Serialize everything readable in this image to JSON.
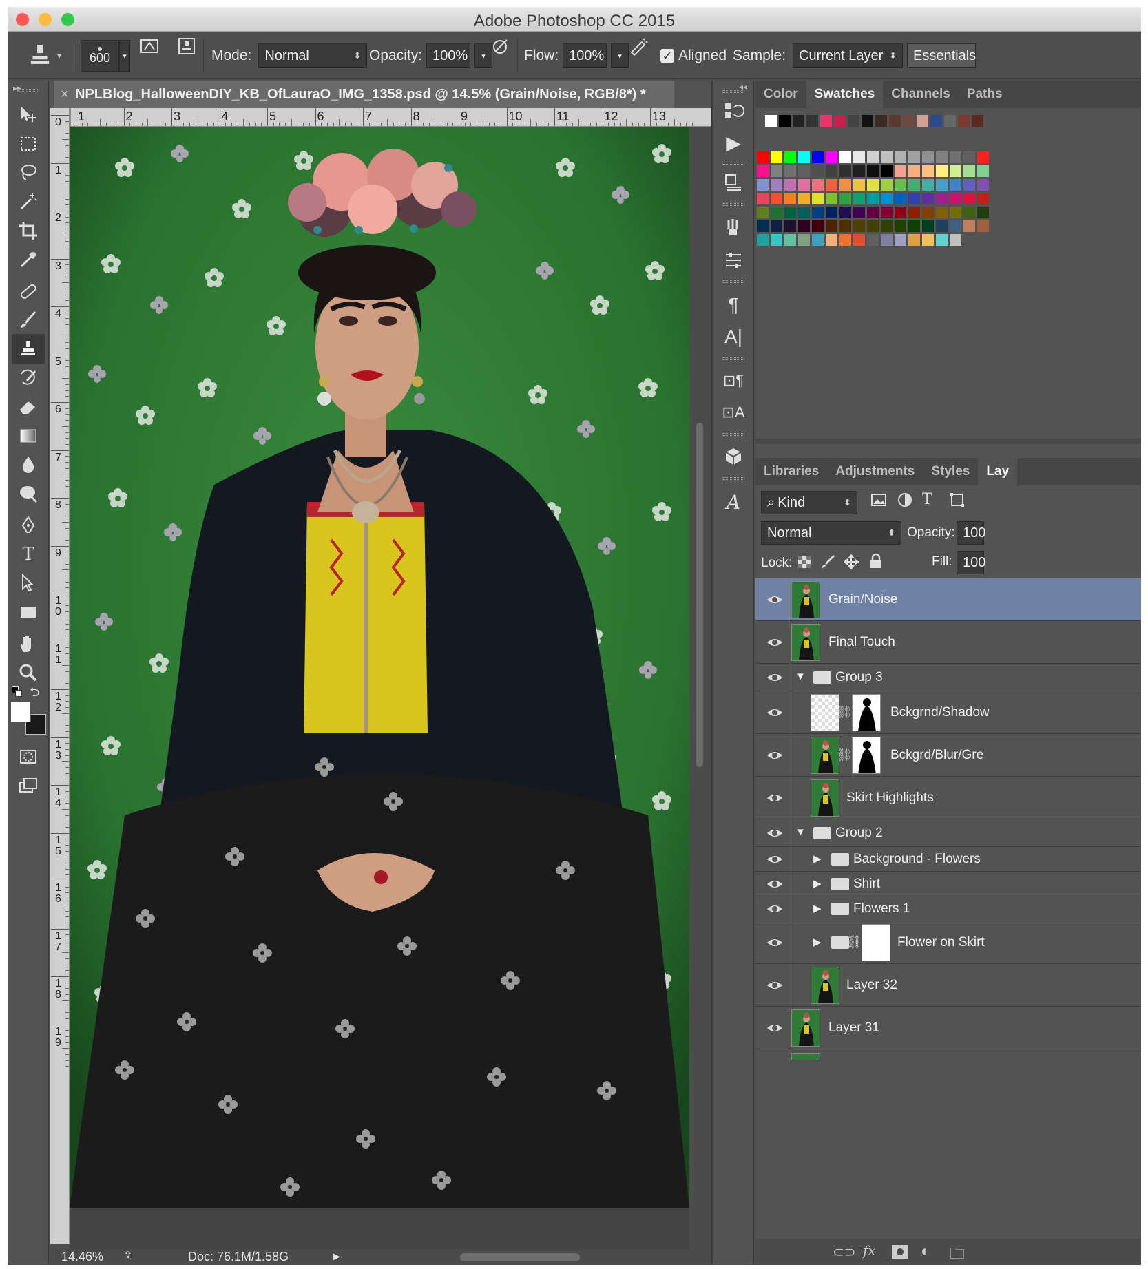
{
  "window": {
    "title": "Adobe Photoshop CC 2015"
  },
  "options": {
    "brush_size": "600",
    "mode_label": "Mode:",
    "mode_value": "Normal",
    "opacity_label": "Opacity:",
    "opacity_value": "100%",
    "flow_label": "Flow:",
    "flow_value": "100%",
    "aligned_label": "Aligned",
    "aligned_checked": true,
    "sample_label": "Sample:",
    "sample_value": "Current Layer",
    "workspace": "Essentials"
  },
  "document": {
    "tab_title": "NPLBlog_HalloweenDIY_KB_OfLauraO_IMG_1358.psd @ 14.5% (Grain/Noise, RGB/8*) *",
    "hruler": [
      "1",
      "2",
      "3",
      "4",
      "5",
      "6",
      "7",
      "8",
      "9",
      "10",
      "11",
      "12",
      "13"
    ],
    "vruler": [
      "0",
      "1",
      "2",
      "3",
      "4",
      "5",
      "6",
      "7",
      "8",
      "9",
      "10",
      "11",
      "12",
      "13",
      "14",
      "15",
      "16",
      "17",
      "18",
      "19"
    ],
    "zoom": "14.46%",
    "doc_size": "Doc: 76.1M/1.58G"
  },
  "panels": {
    "top_tabs": [
      "Color",
      "Swatches",
      "Channels",
      "Paths"
    ],
    "top_active": 1,
    "bottom_tabs": [
      "Libraries",
      "Adjustments",
      "Styles",
      "Lay"
    ],
    "bottom_active": 3
  },
  "layers_panel": {
    "filter_kind": "Kind",
    "blend_mode": "Normal",
    "opacity_label": "Opacity:",
    "opacity_value": "100",
    "lock_label": "Lock:",
    "fill_label": "Fill:",
    "fill_value": "100",
    "layers": [
      {
        "name": "Grain/Noise",
        "selected": true
      },
      {
        "name": "Final Touch"
      },
      {
        "name": "Group 3",
        "group": true
      },
      {
        "name": "Bckgrnd/Shadow"
      },
      {
        "name": "Bckgrd/Blur/Gre"
      },
      {
        "name": "Skirt Highlights"
      },
      {
        "name": "Group 2",
        "group": true
      },
      {
        "name": "Background - Flowers"
      },
      {
        "name": "Shirt"
      },
      {
        "name": "Flowers 1"
      },
      {
        "name": "Flower on Skirt"
      },
      {
        "name": "Layer 32"
      },
      {
        "name": "Layer 31"
      }
    ]
  },
  "colors": {
    "accent_selected": "#6f82a6",
    "panel": "#535353",
    "wallpaper": "#2f7a36"
  }
}
